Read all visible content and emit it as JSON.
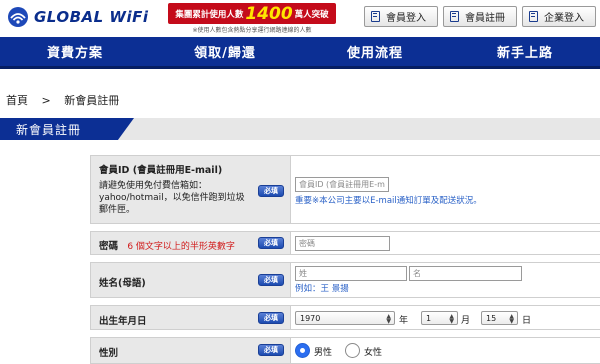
{
  "header": {
    "logo_text": "GLOBAL WiFi",
    "banner": {
      "pre": "集團累計使用人數",
      "number": "1400",
      "post": "萬人突破",
      "note": "※使用人數包含熱點分享運行網路連線的人數"
    },
    "buttons": {
      "login": "會員登入",
      "register": "會員註冊",
      "corporate_login": "企業登入"
    }
  },
  "nav": {
    "items": [
      "資費方案",
      "領取/歸還",
      "使用流程",
      "新手上路"
    ]
  },
  "breadcrumb": {
    "home": "首頁",
    "separator": ">",
    "current": "新會員註冊"
  },
  "section_title": "新會員註冊",
  "form": {
    "required_badge": "必填",
    "member_id": {
      "label": "會員ID (會員註冊用E-mail)",
      "hint": "請避免使用免付費信箱如：yahoo/hotmail，以免信件跑到垃圾郵件匣。",
      "placeholder": "會員ID (會員註冊用E-mail)",
      "note": "重要※本公司主要以E-mail通知訂單及配送狀況。"
    },
    "password": {
      "label": "密碼",
      "hint": "6 個文字以上的半形英數字",
      "placeholder": "密碼"
    },
    "name": {
      "label": "姓名(母語)",
      "last_placeholder": "姓",
      "first_placeholder": "名",
      "example": "例如：王 景揚"
    },
    "birthday": {
      "label": "出生年月日",
      "year": "1970",
      "year_unit": "年",
      "month": "1",
      "month_unit": "月",
      "day": "15",
      "day_unit": "日"
    },
    "gender": {
      "label": "性別",
      "male": "男性",
      "female": "女性",
      "selected": "male"
    }
  },
  "colors": {
    "brand_blue": "#0c2f94",
    "banner_red": "#c40b1a",
    "hint_red": "#d11b1b",
    "note_blue": "#2b62c7"
  }
}
